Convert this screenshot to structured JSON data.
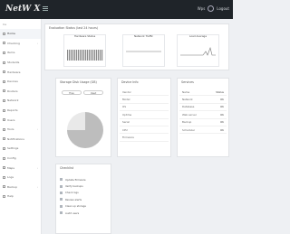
{
  "app": {
    "logo": "NetW X"
  },
  "topbar": {
    "user": "Wps",
    "extra": "Logout"
  },
  "sidebar": {
    "header": "Ca",
    "items": [
      {
        "label": "Home",
        "icon": "home-icon"
      },
      {
        "label": "Checking",
        "icon": "check-icon"
      },
      {
        "label": "Items",
        "icon": "list-icon"
      },
      {
        "label": "Students",
        "icon": "users-icon"
      },
      {
        "label": "Hardware",
        "icon": "server-icon"
      },
      {
        "label": "Devices",
        "icon": "device-icon"
      },
      {
        "label": "Routers",
        "icon": "router-icon"
      },
      {
        "label": "Network",
        "icon": "network-icon"
      },
      {
        "label": "Reports",
        "icon": "report-icon"
      },
      {
        "label": "Users",
        "icon": "user-icon"
      },
      {
        "label": "Tools",
        "icon": "tool-icon"
      },
      {
        "label": "Notifications",
        "icon": "bell-icon"
      },
      {
        "label": "Settings",
        "icon": "gear-icon"
      },
      {
        "label": "Config",
        "icon": "config-icon"
      },
      {
        "label": "Maps",
        "icon": "map-icon"
      },
      {
        "label": "Logs",
        "icon": "log-icon"
      },
      {
        "label": "Backup",
        "icon": "backup-icon"
      },
      {
        "label": "Help",
        "icon": "help-icon"
      }
    ]
  },
  "overview": {
    "title": "Evaluation Status (last 24 hours)",
    "charts": [
      {
        "title": "Hardware Status"
      },
      {
        "title": "Network Traffic"
      },
      {
        "title": "Load Average"
      }
    ]
  },
  "storage": {
    "title": "Storage Disk Usage (GB)",
    "legend": [
      "Free",
      "Used"
    ],
    "chart_data": {
      "type": "pie",
      "series": [
        {
          "name": "Free",
          "value": 75
        },
        {
          "name": "Used",
          "value": 25
        }
      ]
    }
  },
  "device_info": {
    "title": "Device Info",
    "rows": [
      {
        "label": "Vendor",
        "value": ""
      },
      {
        "label": "Model",
        "value": ""
      },
      {
        "label": "OS",
        "value": ""
      },
      {
        "label": "Uptime",
        "value": ""
      },
      {
        "label": "Serial",
        "value": ""
      },
      {
        "label": "CPU",
        "value": ""
      },
      {
        "label": "Firmware",
        "value": ""
      }
    ]
  },
  "services": {
    "title": "Services",
    "rows": [
      {
        "label": "Name",
        "value": "Status"
      },
      {
        "label": "Network",
        "value": "OK"
      },
      {
        "label": "Database",
        "value": "OK"
      },
      {
        "label": "Web server",
        "value": "OK"
      },
      {
        "label": "Backup",
        "value": "OK"
      },
      {
        "label": "Scheduler",
        "value": "OK"
      }
    ]
  },
  "checklist": {
    "title": "Checklist",
    "items": [
      "Update firmware",
      "Verify backups",
      "Check logs",
      "Review alerts",
      "Clean up storage",
      "Audit users"
    ]
  }
}
